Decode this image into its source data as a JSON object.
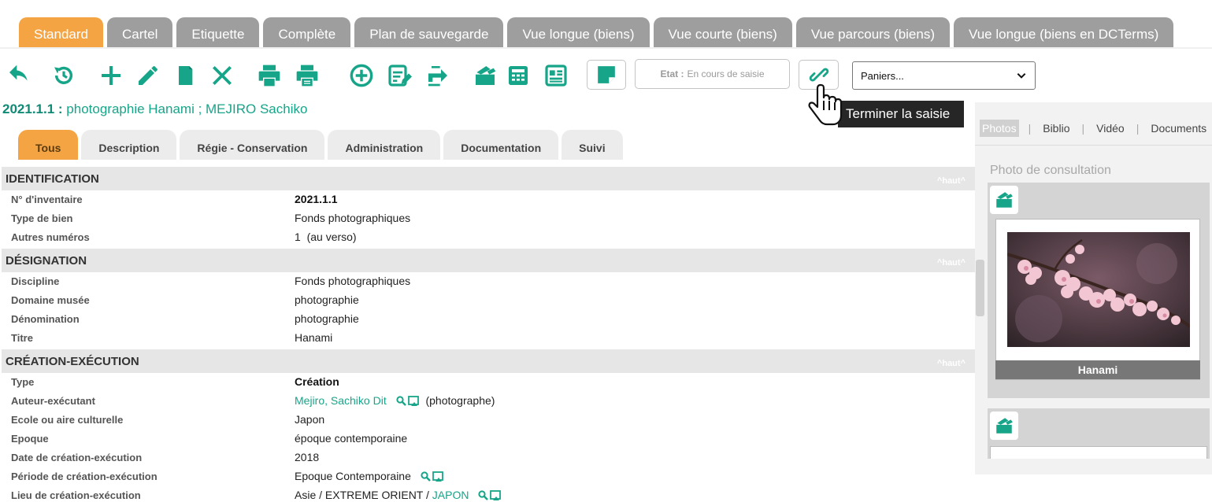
{
  "view_tabs": [
    "Standard",
    "Cartel",
    "Etiquette",
    "Complète",
    "Plan de sauvegarde",
    "Vue longue (biens)",
    "Vue courte (biens)",
    "Vue parcours (biens)",
    "Vue longue (biens en DCTerms)"
  ],
  "toolbar": {
    "etat_label": "Etat :",
    "etat_value": "En cours de saisie",
    "paniers_value": "Paniers...",
    "tooltip": "Terminer la saisie"
  },
  "record": {
    "number": "2021.1.1 :",
    "title": "photographie Hanami ; MEJIRO Sachiko"
  },
  "section_tabs": [
    "Tous",
    "Description",
    "Régie - Conservation",
    "Administration",
    "Documentation",
    "Suivi"
  ],
  "haut": "^haut^",
  "sections": {
    "identification": {
      "title": "IDENTIFICATION",
      "rows": [
        {
          "label": "N° d'inventaire",
          "value": "2021.1.1"
        },
        {
          "label": "Type de bien",
          "value": "Fonds photographiques"
        },
        {
          "label": "Autres numéros",
          "value": "1  (au verso)"
        }
      ]
    },
    "designation": {
      "title": "DÉSIGNATION",
      "rows": [
        {
          "label": "Discipline",
          "value": "Fonds photographiques"
        },
        {
          "label": "Domaine musée",
          "value": "photographie"
        },
        {
          "label": "Dénomination",
          "value": "photographie"
        },
        {
          "label": "Titre",
          "value": "Hanami"
        }
      ]
    },
    "creation": {
      "title": "CRÉATION-EXÉCUTION",
      "rows": [
        {
          "label": "Type",
          "value": "Création"
        },
        {
          "label": "Auteur-exécutant",
          "value": "Mejiro, Sachiko Dit",
          "suffix": "(photographe)"
        },
        {
          "label": "Ecole ou aire culturelle",
          "value": "Japon"
        },
        {
          "label": "Epoque",
          "value": "époque contemporaine"
        },
        {
          "label": "Date de création-exécution",
          "value": "2018"
        },
        {
          "label": "Période de création-exécution",
          "value": "Epoque Contemporaine"
        },
        {
          "label": "Lieu de création-exécution",
          "value": "Asie / EXTREME ORIENT / ",
          "link": "JAPON"
        }
      ]
    }
  },
  "right_panel": {
    "tabs": [
      "Photos",
      "Biblio",
      "Vidéo",
      "Documents"
    ],
    "photo_label": "Photo de consultation",
    "caption": "Hanami"
  },
  "colors": {
    "accent_orange": "#f5a443",
    "tab_grey": "#9e9e9e",
    "icon_teal": "#17a589",
    "link_teal": "#17a589"
  }
}
